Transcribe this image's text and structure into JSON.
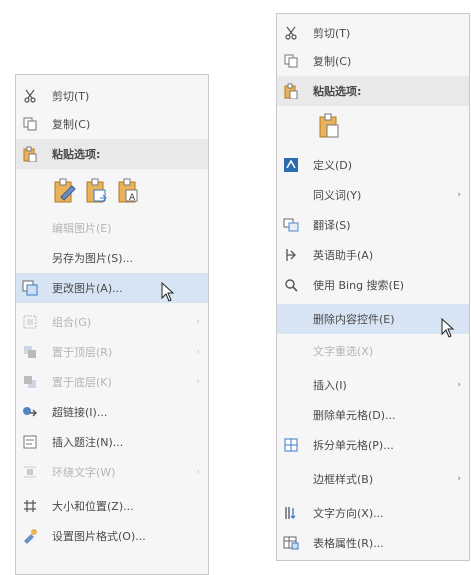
{
  "left_menu": {
    "cut": "剪切(T)",
    "copy": "复制(C)",
    "paste_options": "粘贴选项:",
    "edit_picture": "编辑图片(E)",
    "save_as_picture": "另存为图片(S)...",
    "change_picture": "更改图片(A)...",
    "group": "组合(G)",
    "bring_to_front": "置于顶层(R)",
    "send_to_back": "置于底层(K)",
    "link": "超链接(I)...",
    "insert_caption": "插入题注(N)...",
    "wrap_text": "环绕文字(W)",
    "size_position": "大小和位置(Z)...",
    "format_picture": "设置图片格式(O)..."
  },
  "right_menu": {
    "cut": "剪切(T)",
    "copy": "复制(C)",
    "paste_options": "粘贴选项:",
    "define": "定义(D)",
    "synonyms": "同义词(Y)",
    "translate": "翻译(S)",
    "researcher": "英语助手(A)",
    "search_bing": "使用 Bing 搜索(E)",
    "remove_content_control": "删除内容控件(E)",
    "text_direction_disabled": "文字重选(X)",
    "insert": "插入(I)",
    "delete_cells": "删除单元格(D)...",
    "split_cells": "拆分单元格(P)...",
    "border_styles": "边框样式(B)",
    "text_direction": "文字方向(X)...",
    "table_properties": "表格属性(R)..."
  },
  "colors": {
    "menu_bg": "#f6f6f6",
    "highlight": "#d7e4f3",
    "accent_blue": "#2b6cb0",
    "paste_orange": "#d08a2b"
  },
  "icons": {
    "cut": "scissors-icon",
    "copy": "copy-icon",
    "paste": "clipboard-icon",
    "change_picture": "change-picture-icon",
    "cursor": "mouse-pointer-icon"
  }
}
